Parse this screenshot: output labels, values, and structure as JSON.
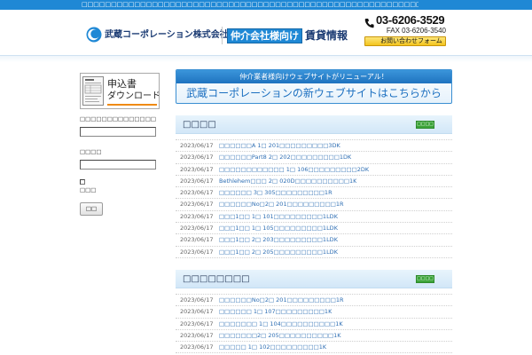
{
  "top_bar": {
    "tagline": "□□□□□□□□□□□□□□□□□□□□□□□□□□□□□□□□□□□□□□□□□□□□□□□□□□□□□□□□□□□□□□"
  },
  "header": {
    "company_name": "武蔵コーポレーション株式会社",
    "site_label_audience": "仲介会社様向け",
    "site_label_title": "賃貸情報",
    "phone": "03-6206-3529",
    "fax": "FAX 03-6206-3540",
    "contact_button": "お問い合わせフォーム"
  },
  "sidebar": {
    "download_banner": {
      "line1": "申込書",
      "line2": "ダウンロード"
    },
    "login": {
      "id_label": "□□□□□□□□□□□□□□",
      "id_value": "",
      "password_label": "□□□□",
      "password_value": "",
      "remember_label": "□□□",
      "remember_checked": false,
      "submit_label": "□□"
    }
  },
  "renewal_banner": {
    "notice": "仲介業者様向けウェブサイトがリニューアル！",
    "link_text": "武蔵コーポレーションの新ウェブサイトはこちらから"
  },
  "sections": [
    {
      "title": "□□□□",
      "more_label": "□□□□□",
      "items": [
        {
          "date": "2023/06/17",
          "title": "□□□□□□A 1□ 201□□□□□□□□□3DK"
        },
        {
          "date": "2023/06/17",
          "title": "□□□□□□Part8 2□ 202□□□□□□□□□1DK"
        },
        {
          "date": "2023/06/17",
          "title": "□□□□□□□□□□□□ 1□ 106□□□□□□□□□2DK"
        },
        {
          "date": "2023/06/17",
          "title": "Bethlehem□□□ 2□ 020D□□□□□□□□□□1K"
        },
        {
          "date": "2023/06/17",
          "title": "□□□□□□ 3□ 305□□□□□□□□□1R"
        },
        {
          "date": "2023/06/17",
          "title": "□□□□□□No□2□ 201□□□□□□□□□1R"
        },
        {
          "date": "2023/06/17",
          "title": "□□□1□□ 1□ 101□□□□□□□□□1LDK"
        },
        {
          "date": "2023/06/17",
          "title": "□□□1□□ 1□ 105□□□□□□□□□1LDK"
        },
        {
          "date": "2023/06/17",
          "title": "□□□1□□ 2□ 203□□□□□□□□□1LDK"
        },
        {
          "date": "2023/06/17",
          "title": "□□□1□□ 2□ 205□□□□□□□□□1LDK"
        }
      ]
    },
    {
      "title": "□□□□□□□□",
      "more_label": "□□□□□",
      "items": [
        {
          "date": "2023/06/17",
          "title": "□□□□□□No□2□ 201□□□□□□□□□1R"
        },
        {
          "date": "2023/06/17",
          "title": "□□□□□□ 1□ 107□□□□□□□□□1K"
        },
        {
          "date": "2023/06/17",
          "title": "□□□□□□□ 1□ 104□□□□□□□□□□1K"
        },
        {
          "date": "2023/06/17",
          "title": "□□□□□□□2□ 205□□□□□□□□□□1K"
        },
        {
          "date": "2023/06/17",
          "title": "□□□□□ 1□ 102□□□□□□□□□1K"
        }
      ]
    }
  ],
  "colors": {
    "brand": "#1f88d5",
    "navy": "#1b3b73",
    "link": "#2f6fb4",
    "green": "#3da43a",
    "yellow": "#f4c41c",
    "orange": "#ef8a12"
  },
  "icons": {
    "logo": "company-logo-icon",
    "phone": "phone-icon",
    "mail": "mail-icon",
    "download": "application-form-icon"
  }
}
